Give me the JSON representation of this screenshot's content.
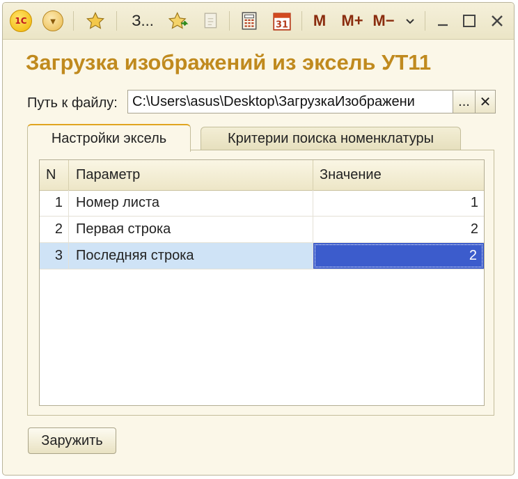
{
  "window": {
    "toolbar": {
      "logo_text": "1С",
      "history_label": "З...",
      "m_label": "M",
      "m_plus_label": "M+",
      "m_minus_label": "M−",
      "calendar_day": "31"
    },
    "title": "Загрузка изображений из эксель УТ11"
  },
  "form": {
    "path_label": "Путь к файлу:",
    "path_value": "C:\\Users\\asus\\Desktop\\ЗагрузкаИзображени",
    "browse_label": "...",
    "clear_label": "✕"
  },
  "tabs": [
    {
      "label": "Настройки эксель",
      "active": true
    },
    {
      "label": "Критерии поиска номенклатуры",
      "active": false
    }
  ],
  "table": {
    "columns": [
      "N",
      "Параметр",
      "Значение"
    ],
    "rows": [
      {
        "n": "1",
        "param": "Номер листа",
        "value": "1"
      },
      {
        "n": "2",
        "param": "Первая строка",
        "value": "2"
      },
      {
        "n": "3",
        "param": "Последняя строка",
        "value": "2",
        "selected": true
      }
    ]
  },
  "buttons": {
    "load_label": "Заружить"
  },
  "colors": {
    "title": "#c08a1e",
    "selection_row": "#cfe3f6",
    "selection_cell": "#3c5ccc",
    "window_bg": "#fbf7e8"
  }
}
